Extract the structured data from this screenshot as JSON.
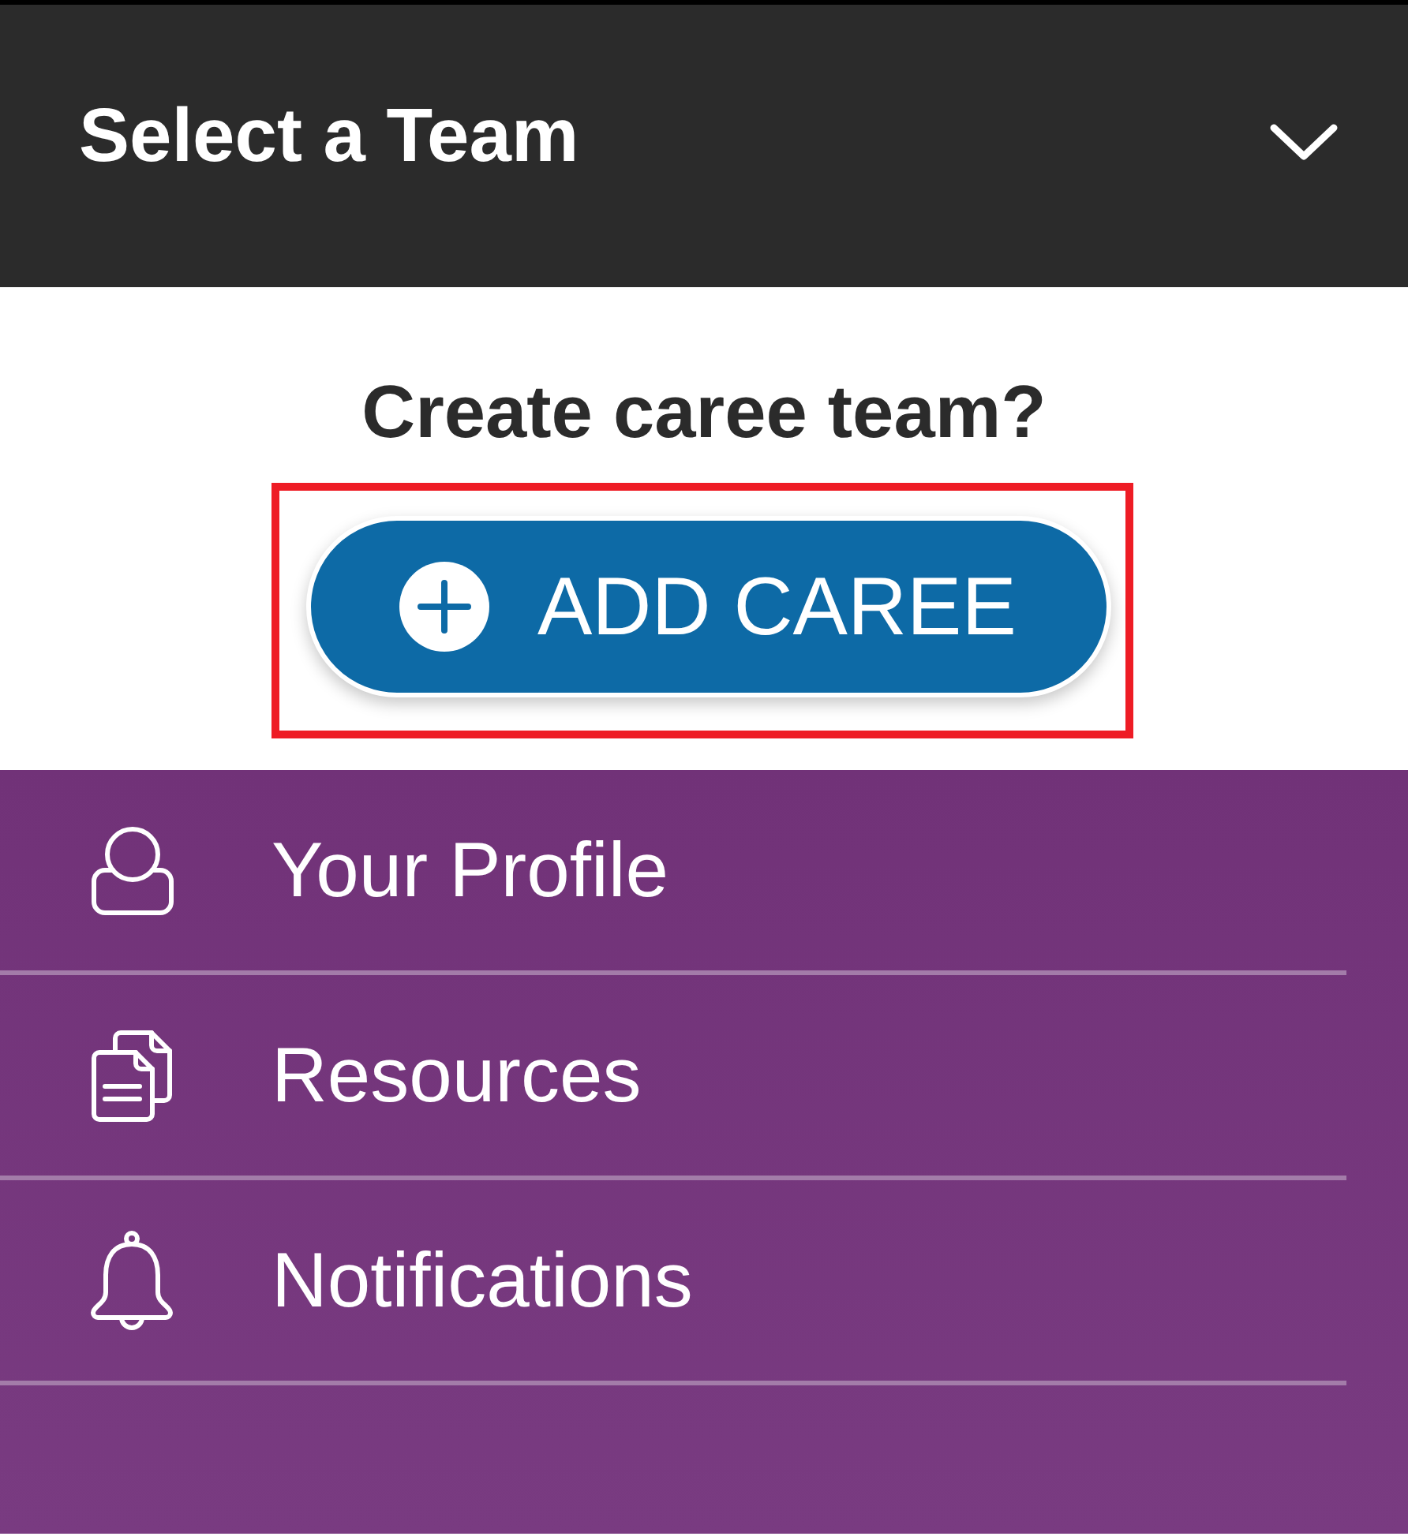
{
  "header": {
    "title": "Select a Team"
  },
  "prompt": "Create caree team?",
  "add_button": {
    "label": "ADD CAREE",
    "highlighted": true
  },
  "menu": {
    "items": [
      {
        "label": "Your Profile",
        "kind": "profile"
      },
      {
        "label": "Resources",
        "kind": "resources"
      },
      {
        "label": "Notifications",
        "kind": "notifications"
      }
    ]
  }
}
